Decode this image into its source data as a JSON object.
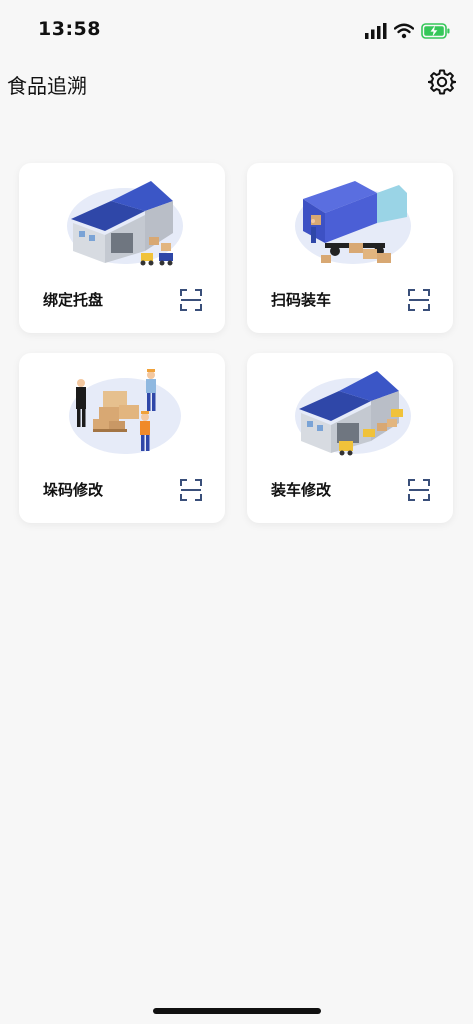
{
  "status_bar": {
    "time": "13:58"
  },
  "header": {
    "title": "食品追溯",
    "settings_icon": "gear-icon"
  },
  "cards": [
    {
      "label": "绑定托盘",
      "illustration": "warehouse-forklift-illustration",
      "scan_icon": "scan-icon"
    },
    {
      "label": "扫码装车",
      "illustration": "truck-loading-illustration",
      "scan_icon": "scan-icon"
    },
    {
      "label": "垛码修改",
      "illustration": "workers-boxes-illustration",
      "scan_icon": "scan-icon"
    },
    {
      "label": "装车修改",
      "illustration": "warehouse-forklifts-illustration",
      "scan_icon": "scan-icon"
    }
  ],
  "colors": {
    "scan_icon": "#3a4f7a",
    "roof_blue": "#2f47a8",
    "background": "#f7f7f7"
  }
}
